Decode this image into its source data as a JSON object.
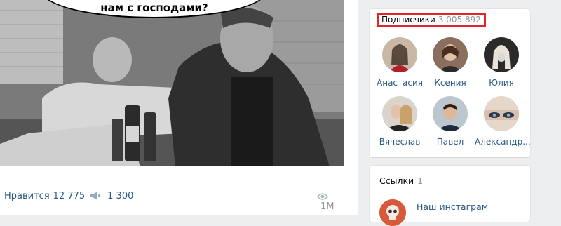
{
  "post": {
    "bubble_text": "нам с господами?",
    "likes": {
      "label": "Нравится",
      "count": "12 775"
    },
    "shares": {
      "count": "1 300"
    },
    "views": {
      "count": "1M"
    }
  },
  "subscribers": {
    "label": "Подписчики",
    "count": "3 005 892",
    "highlight_color": "#e0242a",
    "people": [
      {
        "name": "Анастасия"
      },
      {
        "name": "Ксения"
      },
      {
        "name": "Юлия"
      },
      {
        "name": "Вячеслав"
      },
      {
        "name": "Павел"
      },
      {
        "name": "Александр..."
      }
    ]
  },
  "links": {
    "label": "Ссылки",
    "count": "1",
    "items": [
      {
        "title": "Наш инстаграм",
        "icon": "skull-icon"
      }
    ]
  },
  "colors": {
    "link": "#2a5885",
    "muted": "#939393",
    "background": "#edeef0"
  }
}
